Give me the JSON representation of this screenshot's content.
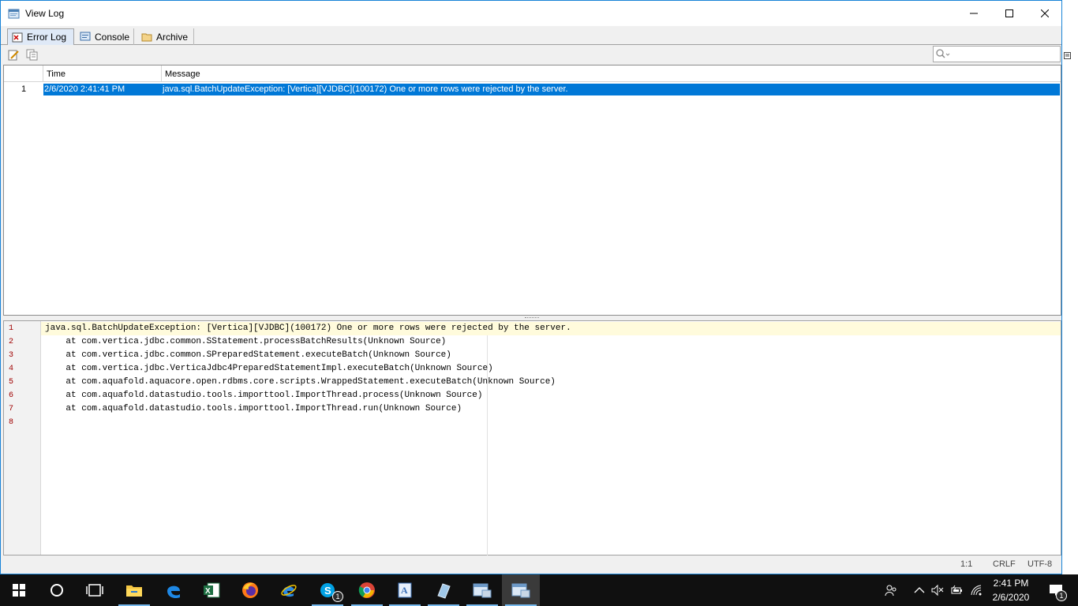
{
  "window": {
    "title": "View Log",
    "controls": {
      "minimize": "minimize-icon",
      "maximize": "maximize-icon",
      "close": "close-icon"
    }
  },
  "tabs": [
    {
      "label": "Error Log",
      "icon": "error-log-icon",
      "active": true
    },
    {
      "label": "Console",
      "icon": "console-icon",
      "active": false
    },
    {
      "label": "Archive",
      "icon": "folder-icon",
      "active": false
    }
  ],
  "toolbar": {
    "buttons": [
      "edit-icon",
      "copy-icon"
    ],
    "search_placeholder": ""
  },
  "table": {
    "columns": [
      "Time",
      "Message"
    ],
    "rows": [
      {
        "num": "1",
        "time": "2/6/2020 2:41:41 PM",
        "message": "java.sql.BatchUpdateException: [Vertica][VJDBC](100172) One or more rows were rejected by the server."
      }
    ]
  },
  "editor": {
    "lines": [
      {
        "num": "1",
        "text": "java.sql.BatchUpdateException: [Vertica][VJDBC](100172) One or more rows were rejected by the server."
      },
      {
        "num": "2",
        "text": "    at com.vertica.jdbc.common.SStatement.processBatchResults(Unknown Source)"
      },
      {
        "num": "3",
        "text": "    at com.vertica.jdbc.common.SPreparedStatement.executeBatch(Unknown Source)"
      },
      {
        "num": "4",
        "text": "    at com.vertica.jdbc.VerticaJdbc4PreparedStatementImpl.executeBatch(Unknown Source)"
      },
      {
        "num": "5",
        "text": "    at com.aquafold.aquacore.open.rdbms.core.scripts.WrappedStatement.executeBatch(Unknown Source)"
      },
      {
        "num": "6",
        "text": "    at com.aquafold.datastudio.tools.importtool.ImportThread.process(Unknown Source)"
      },
      {
        "num": "7",
        "text": "    at com.aquafold.datastudio.tools.importtool.ImportThread.run(Unknown Source)"
      },
      {
        "num": "8",
        "text": ""
      }
    ]
  },
  "status": {
    "position": "1:1",
    "line_ending": "CRLF",
    "encoding": "UTF-8"
  },
  "taskbar": {
    "apps": [
      "start-icon",
      "cortana-icon",
      "task-view-icon",
      "file-explorer-icon",
      "edge-icon",
      "excel-icon",
      "firefox-icon",
      "internet-explorer-icon",
      "skype-icon",
      "chrome-icon",
      "wordpad-icon",
      "app-icon",
      "datastudio-icon",
      "datastudio-window-icon"
    ],
    "skype_badge": "1",
    "notification_badge": "1",
    "clock_time": "2:41 PM",
    "clock_date": "2/6/2020"
  },
  "colors": {
    "selection": "#0078d7",
    "current_line": "#fffbdc",
    "line_number": "#a00000",
    "taskbar": "#101010"
  }
}
